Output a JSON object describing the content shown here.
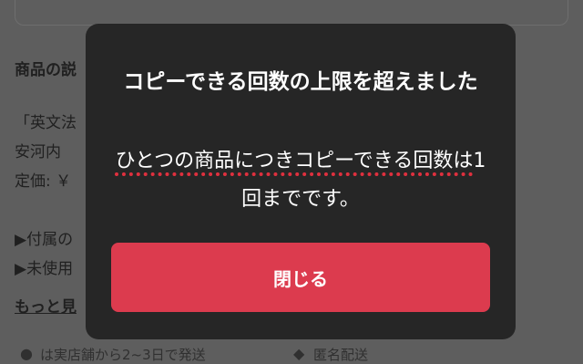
{
  "background": {
    "section_title": "商品の説",
    "lines": [
      "「英文法",
      "安河内",
      "定価: ￥"
    ],
    "bullets": [
      "▶付属の",
      "▶未使用"
    ],
    "more_link": "もっと見",
    "bottom_text_1": "は実店舗から2~3日で発送",
    "bottom_text_2": "匿名配送"
  },
  "modal": {
    "title": "コピーできる回数の上限を超えました",
    "message_part1": "ひとつの商品につきコピーできる回数は",
    "message_part2": "1回までです。",
    "close_label": "閉じる"
  },
  "colors": {
    "overlay": "#5e5e5e",
    "modal_bg": "#262626",
    "button": "#dc3b4e",
    "highlight": "#e0303e"
  }
}
